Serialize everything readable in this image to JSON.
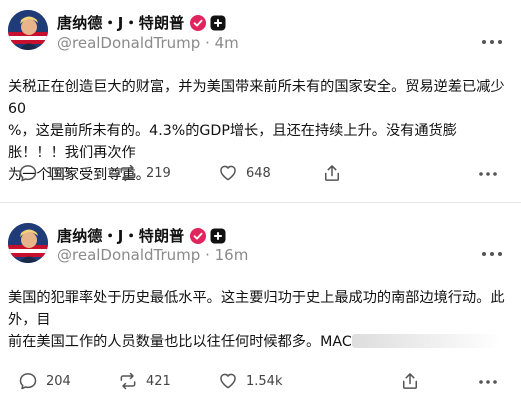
{
  "posts": [
    {
      "author_name": "唐纳德・J・特朗普",
      "handle": "@realDonaldTrump",
      "time_sep": " · ",
      "time": "4m",
      "lines": [
        "关税正在创造巨大的财富，并为美国带来前所未有的国家安全。贸易逆差已减少60",
        "%，这是前所未有的。4.3%的GDP增长，且还在持续上升。没有通货膨胀！！！我们再次作",
        "为一个国家受到尊重。"
      ],
      "replies": "103",
      "reposts": "219",
      "likes": "648"
    },
    {
      "author_name": "唐纳德・J・特朗普",
      "handle": "@realDonaldTrump",
      "time_sep": " · ",
      "time": "16m",
      "lines": [
        "美国的犯罪率处于历史最低水平。这主要归功于史上最成功的南部边境行动。此外，目",
        "前在美国工作的人员数量也比以往任何时候都多。MAC"
      ],
      "replies": "204",
      "reposts": "421",
      "likes": "1.54k"
    }
  ],
  "colors": {
    "verified_badge": "#e0245e",
    "handle_gray": "#8a8a8a",
    "icon_gray": "#555555"
  },
  "icons": [
    "avatar",
    "verified-icon",
    "plus-badge-icon",
    "more-icon",
    "reply-icon",
    "repost-icon",
    "like-icon",
    "share-icon"
  ]
}
